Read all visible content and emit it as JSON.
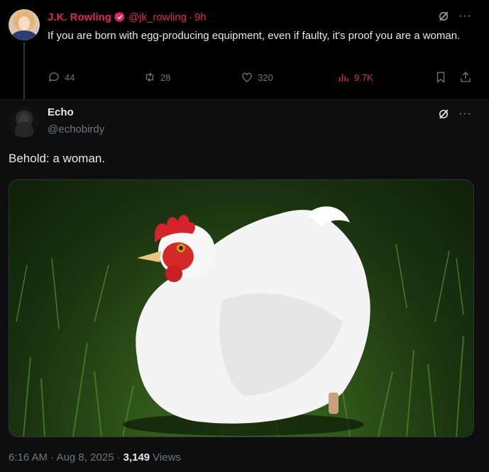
{
  "parent_tweet": {
    "author_name": "J.K. Rowling",
    "handle": "@jk_rowling",
    "separator": "·",
    "time": "9h",
    "text": "If you are born with egg-producing equipment, even if faulty, it's proof you are a woman.",
    "actions": {
      "replies": "44",
      "retweets": "28",
      "likes": "320",
      "views": "9.7K"
    },
    "icons": [
      "grok-icon",
      "more-icon",
      "reply-icon",
      "retweet-icon",
      "like-icon",
      "views-icon",
      "bookmark-icon",
      "share-icon"
    ],
    "colors": {
      "name": "#e0245e",
      "verified": "#e0245e"
    }
  },
  "reply_tweet": {
    "author_name": "Echo",
    "handle": "@echobirdy",
    "text": "Behold: a woman.",
    "timestamp": "6:16 AM · Aug 8, 2025 ·",
    "views_count": "3,149",
    "views_label": "Views",
    "icons": [
      "grok-icon",
      "more-icon"
    ]
  }
}
